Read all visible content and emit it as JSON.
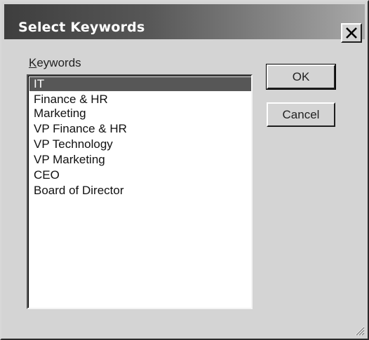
{
  "window": {
    "title": "Select Keywords"
  },
  "keywords": {
    "label_mnemonic": "K",
    "label_rest": "eywords",
    "items": [
      "IT",
      "Finance & HR",
      "Marketing",
      "VP Finance & HR",
      "VP Technology",
      "VP Marketing",
      "CEO",
      "Board of Director"
    ],
    "selected": "IT"
  },
  "buttons": {
    "ok_label": "OK",
    "cancel_label": "Cancel"
  },
  "icons": {
    "close": "close-icon",
    "resize": "resize-grip-icon"
  },
  "colors": {
    "selection": "#575757",
    "title_bar_start": "#3e3e3e",
    "title_bar_end": "#a8a8a8"
  }
}
